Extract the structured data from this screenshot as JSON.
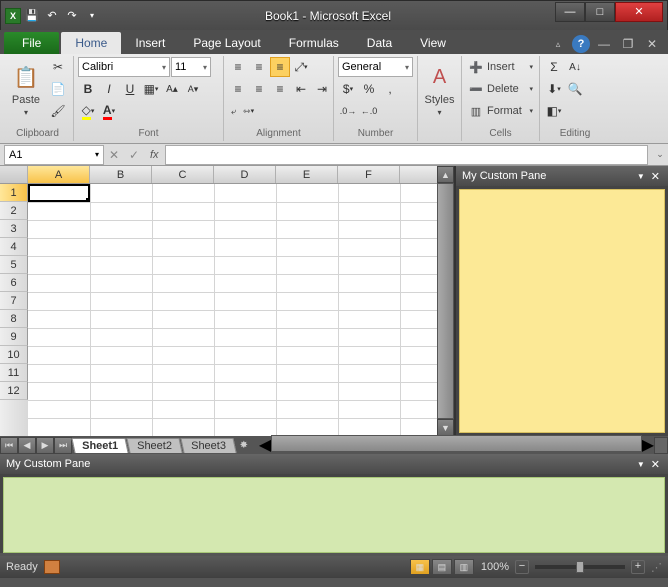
{
  "window": {
    "title": "Book1 - Microsoft Excel",
    "minimize": "—",
    "maximize": "□",
    "close": "✕"
  },
  "qat": {
    "save_tip": "Save",
    "undo_tip": "Undo",
    "redo_tip": "Redo"
  },
  "tabs": {
    "file": "File",
    "items": [
      "Home",
      "Insert",
      "Page Layout",
      "Formulas",
      "Data",
      "View"
    ],
    "active": "Home"
  },
  "ribbon": {
    "clipboard": {
      "label": "Clipboard",
      "paste": "Paste"
    },
    "font": {
      "label": "Font",
      "font_name": "Calibri",
      "font_size": "11",
      "bold": "B",
      "italic": "I",
      "underline": "U"
    },
    "alignment": {
      "label": "Alignment",
      "wrap": "Wrap Text",
      "merge": "Merge & Center"
    },
    "number": {
      "label": "Number",
      "format": "General"
    },
    "styles": {
      "label": "",
      "button": "Styles"
    },
    "cells": {
      "label": "Cells",
      "insert": "Insert",
      "delete": "Delete",
      "format": "Format"
    },
    "editing": {
      "label": "Editing",
      "autosum": "Σ",
      "sort": "Sort & Filter",
      "find": "Find & Select"
    }
  },
  "formula_bar": {
    "name_box": "A1",
    "fx": "fx",
    "formula": ""
  },
  "grid": {
    "columns": [
      "A",
      "B",
      "C",
      "D",
      "E",
      "F"
    ],
    "rows": [
      "1",
      "2",
      "3",
      "4",
      "5",
      "6",
      "7",
      "8",
      "9",
      "10",
      "11",
      "12"
    ],
    "active_col": "A",
    "active_row": "1"
  },
  "sheets": {
    "items": [
      "Sheet1",
      "Sheet2",
      "Sheet3"
    ],
    "active": "Sheet1"
  },
  "pane_right": {
    "title": "My Custom Pane",
    "color": "#fce996"
  },
  "pane_bottom": {
    "title": "My Custom Pane",
    "color": "#d4e8b0"
  },
  "status": {
    "ready": "Ready",
    "zoom": "100%",
    "minus": "−",
    "plus": "+"
  }
}
